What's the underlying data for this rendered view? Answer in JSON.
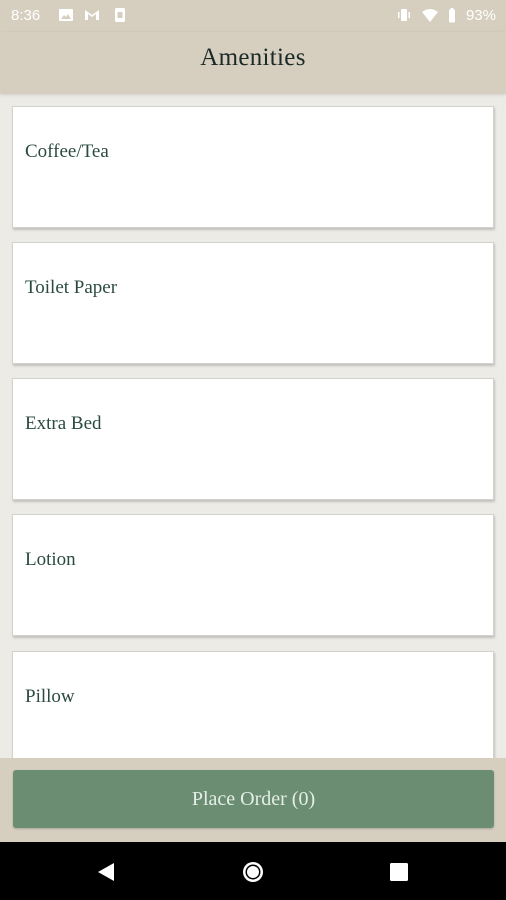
{
  "status_bar": {
    "time": "8:36",
    "battery": "93%",
    "icons": [
      "image-icon",
      "gmail-icon",
      "device-icon",
      "vibrate-icon",
      "wifi-icon",
      "battery-icon"
    ]
  },
  "app_bar": {
    "title": "Amenities"
  },
  "amenities": [
    {
      "label": "Coffee/Tea"
    },
    {
      "label": "Toilet Paper"
    },
    {
      "label": "Extra Bed"
    },
    {
      "label": "Lotion"
    },
    {
      "label": "Pillow"
    }
  ],
  "footer": {
    "order_button": "Place Order (0)"
  },
  "nav_bar": {
    "icons": [
      "back-icon",
      "home-icon",
      "recents-icon"
    ]
  },
  "colors": {
    "header_bg": "#d6cfc0",
    "page_bg": "#ecebe6",
    "accent_button": "#6b8e73",
    "item_text": "#2b4a3f"
  }
}
